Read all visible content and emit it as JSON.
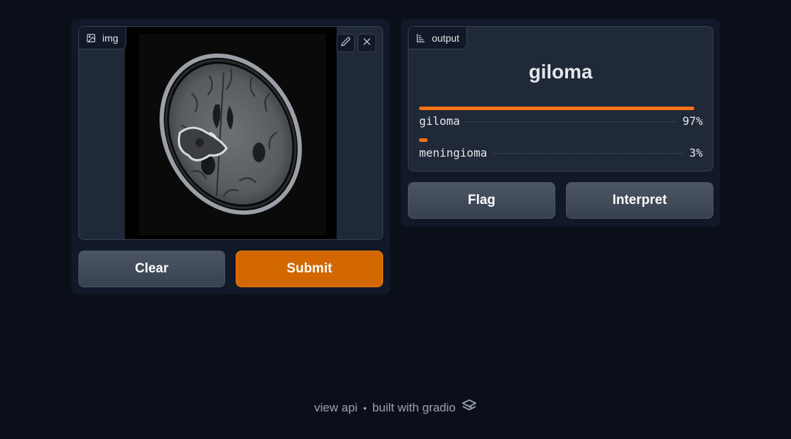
{
  "input": {
    "label": "img",
    "icon": "image-icon",
    "tools": [
      "edit-icon",
      "close-icon"
    ]
  },
  "buttons": {
    "clear": "Clear",
    "submit": "Submit",
    "flag": "Flag",
    "interpret": "Interpret"
  },
  "output": {
    "label": "output",
    "icon": "chart-icon",
    "predicted": "giloma",
    "confidences": [
      {
        "label": "giloma",
        "value": 0.97,
        "display": "97%"
      },
      {
        "label": "meningioma",
        "value": 0.03,
        "display": "3%"
      }
    ]
  },
  "footer": {
    "view_api": "view api",
    "separator": "•",
    "built_with": "built with gradio"
  },
  "colors": {
    "background": "#0b0f19",
    "panel": "#111827",
    "accent": "#f97316",
    "submit": "#d26700"
  }
}
